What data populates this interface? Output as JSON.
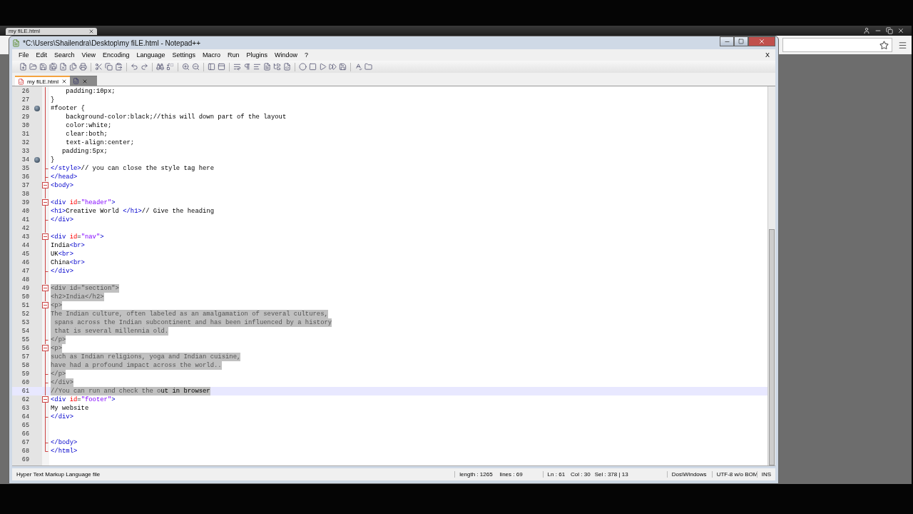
{
  "browser": {
    "tab_title": "my fiLE.html"
  },
  "window": {
    "title": "*C:\\Users\\Shailendra\\Desktop\\my fiLE.html - Notepad++"
  },
  "menu": [
    "File",
    "Edit",
    "Search",
    "View",
    "Encoding",
    "Language",
    "Settings",
    "Macro",
    "Run",
    "Plugins",
    "Window",
    "?"
  ],
  "menu_close": "X",
  "tabs": [
    {
      "label": "my fiLE.html",
      "selected": true
    },
    {
      "selected": false
    }
  ],
  "lines": [
    {
      "number": "26",
      "text": "    padding:10px;",
      "kind": "line",
      "bookmark": false,
      "selected": false
    },
    {
      "number": "27",
      "text": "}",
      "kind": "line",
      "bookmark": false,
      "selected": false
    },
    {
      "number": "28",
      "text": "#footer {",
      "kind": "line",
      "bookmark": true,
      "selected": false
    },
    {
      "number": "29",
      "text": "    background-color:black;//this will down part of the layout",
      "kind": "line",
      "bookmark": false,
      "selected": false
    },
    {
      "number": "30",
      "text": "    color:white;",
      "kind": "line",
      "bookmark": false,
      "selected": false
    },
    {
      "number": "31",
      "text": "    clear:both;",
      "kind": "line",
      "bookmark": false,
      "selected": false
    },
    {
      "number": "32",
      "text": "    text-align:center;",
      "kind": "line",
      "bookmark": false,
      "selected": false
    },
    {
      "number": "33",
      "text": "   padding:5px;",
      "kind": "line",
      "bookmark": false,
      "selected": false
    },
    {
      "number": "34",
      "text": "}",
      "kind": "line",
      "bookmark": true,
      "selected": false
    },
    {
      "number": "35",
      "text": "</style>// you can close the style tag here",
      "kind": "end",
      "bookmark": false,
      "selected": false
    },
    {
      "number": "36",
      "text": "</head>",
      "kind": "end",
      "bookmark": false,
      "selected": false
    },
    {
      "number": "37",
      "text": "<body>",
      "kind": "open",
      "bookmark": false,
      "selected": false
    },
    {
      "number": "38",
      "kind": "line",
      "bookmark": false
    },
    {
      "number": "39",
      "text": "<div id=\"header\">",
      "kind": "open",
      "bookmark": false,
      "selected": false
    },
    {
      "number": "40",
      "text": "<h1>Creative World </h1>// Give the heading",
      "kind": "line",
      "bookmark": false,
      "selected": false
    },
    {
      "number": "41",
      "text": "</div>",
      "kind": "end",
      "bookmark": false,
      "selected": false
    },
    {
      "number": "42",
      "kind": "line",
      "bookmark": false
    },
    {
      "number": "43",
      "text": "<div id=\"nav\">",
      "kind": "open",
      "bookmark": false,
      "selected": false
    },
    {
      "number": "44",
      "text": "India<br>",
      "kind": "line",
      "bookmark": false,
      "selected": false
    },
    {
      "number": "45",
      "text": "UK<br>",
      "kind": "line",
      "bookmark": false,
      "selected": false
    },
    {
      "number": "46",
      "text": "China<br>",
      "kind": "line",
      "bookmark": false,
      "selected": false
    },
    {
      "number": "47",
      "text": "</div>",
      "kind": "end",
      "bookmark": false,
      "selected": false
    },
    {
      "number": "48",
      "kind": "line",
      "bookmark": false
    },
    {
      "number": "49",
      "text": "<div id=\"section\">",
      "kind": "open",
      "bookmark": false,
      "selected": true
    },
    {
      "number": "50",
      "text": "<h2>India</h2>",
      "kind": "line",
      "bookmark": false,
      "selected": true
    },
    {
      "number": "51",
      "text": "<p>",
      "kind": "open",
      "bookmark": false,
      "selected": true
    },
    {
      "number": "52",
      "text": "The Indian culture, often labeled as an amalgamation of several cultures,",
      "kind": "line",
      "bookmark": false,
      "selected": true
    },
    {
      "number": "53",
      "text": " spans across the Indian subcontinent and has been influenced by a history",
      "kind": "line",
      "bookmark": false,
      "selected": true
    },
    {
      "number": "54",
      "text": " that is several millennia old.",
      "kind": "line",
      "bookmark": false,
      "selected": true
    },
    {
      "number": "55",
      "text": "</p>",
      "kind": "end",
      "bookmark": false,
      "selected": true
    },
    {
      "number": "56",
      "text": "<p>",
      "kind": "open",
      "bookmark": false,
      "selected": true
    },
    {
      "number": "57",
      "text": "such as Indian religions, yoga and Indian cuisine,",
      "kind": "line",
      "bookmark": false,
      "selected": true
    },
    {
      "number": "58",
      "text": "have had a profound impact across the world..",
      "kind": "line",
      "bookmark": false,
      "selected": true
    },
    {
      "number": "59",
      "text": "</p>",
      "kind": "end",
      "bookmark": false,
      "selected": true
    },
    {
      "number": "60",
      "text": "</div>",
      "kind": "end",
      "bookmark": false,
      "selected": true
    },
    {
      "number": "61",
      "text": "//You can run and check the o",
      "tail": "ut in browser",
      "kind": "line",
      "bookmark": false,
      "selected": true,
      "current": true
    },
    {
      "number": "62",
      "text": "<div id=\"footer\">",
      "kind": "open",
      "bookmark": false,
      "selected": false
    },
    {
      "number": "63",
      "text": "My website",
      "kind": "line",
      "bookmark": false,
      "selected": false
    },
    {
      "number": "64",
      "text": "</div>",
      "kind": "end",
      "bookmark": false,
      "selected": false
    },
    {
      "number": "65",
      "kind": "line",
      "bookmark": false
    },
    {
      "number": "66",
      "kind": "line",
      "bookmark": false
    },
    {
      "number": "67",
      "text": "</body>",
      "kind": "end",
      "bookmark": false,
      "selected": false
    },
    {
      "number": "68",
      "text": "</html>",
      "kind": "last",
      "bookmark": false,
      "selected": false
    },
    {
      "number": "69",
      "kind": "none",
      "bookmark": false
    }
  ],
  "status_bar": {
    "file_type": "Hyper Text Markup Language file",
    "length": "length : 1265",
    "lines": "lines : 69",
    "line": "Ln : 61",
    "column": "Col : 30",
    "selection": "Sel : 378 | 13",
    "eol": "Dos\\Windows",
    "encoding": "UTF-8 w/o BOM",
    "mode": "INS"
  }
}
